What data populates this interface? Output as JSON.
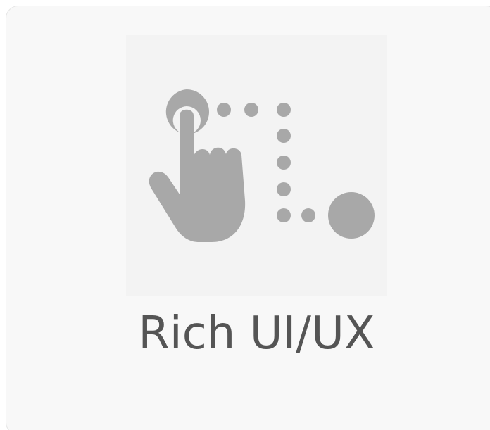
{
  "card": {
    "icon": "touch-gesture-icon",
    "title": "Rich UI/UX"
  },
  "colors": {
    "card_background": "#f8f8f8",
    "icon_tile_background": "#f3f3f3",
    "icon_fill": "#a8a8a8",
    "title_text": "#555555"
  }
}
